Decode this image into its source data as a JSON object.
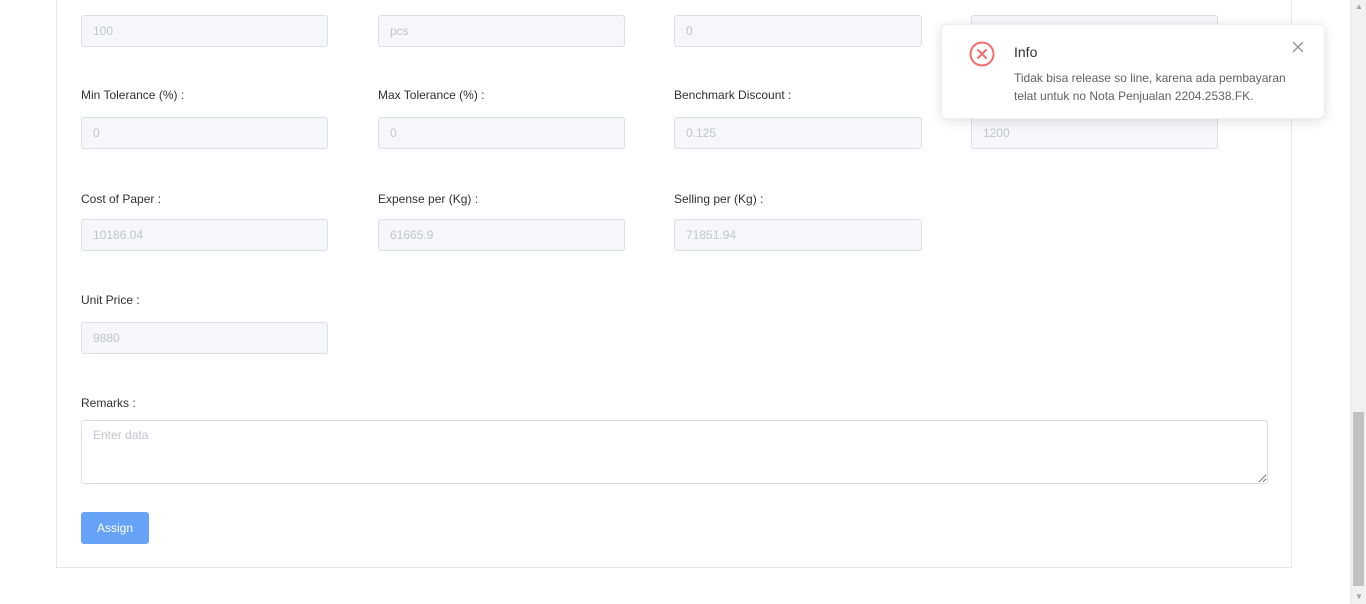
{
  "form": {
    "row1": {
      "quantity_value": "100",
      "unit_value": "pcs",
      "third_value": "0",
      "fourth_value": ""
    },
    "row2": {
      "min_tolerance_label": "Min Tolerance (%) :",
      "min_tolerance_value": "0",
      "max_tolerance_label": "Max Tolerance (%) :",
      "max_tolerance_value": "0",
      "benchmark_discount_label": "Benchmark Discount :",
      "benchmark_discount_value": "0.125",
      "fourth_value": "1200"
    },
    "row3": {
      "cost_of_paper_label": "Cost of Paper :",
      "cost_of_paper_value": "10186.04",
      "expense_per_kg_label": "Expense per (Kg) :",
      "expense_per_kg_value": "61665.9",
      "selling_per_kg_label": "Selling per (Kg) :",
      "selling_per_kg_value": "71851.94"
    },
    "row4": {
      "unit_price_label": "Unit Price :",
      "unit_price_value": "9880"
    },
    "remarks_label": "Remarks :",
    "remarks_placeholder": "Enter data",
    "assign_label": "Assign"
  },
  "notification": {
    "title": "Info",
    "message": "Tidak bisa release so line, karena ada pembayaran telat untuk no Nota Penjualan 2204.2538.FK.",
    "icon": "error-circle-icon",
    "color": "#f56c6c"
  },
  "colors": {
    "primary_button": "#66a3f7",
    "disabled_input_bg": "#f5f7fa"
  }
}
